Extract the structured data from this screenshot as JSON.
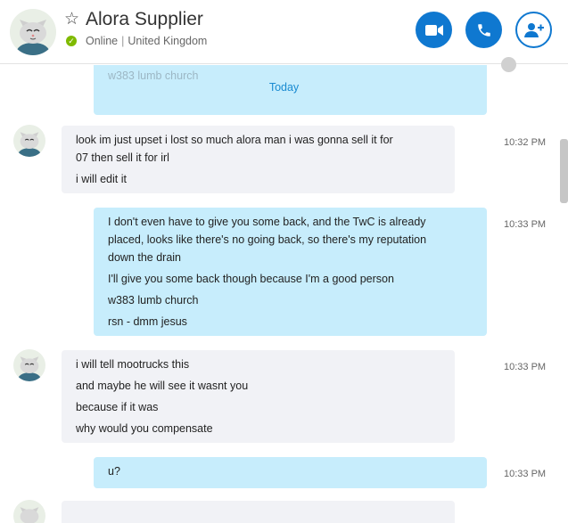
{
  "header": {
    "contact_name": "Alora Supplier",
    "status": "Online",
    "location": "United Kingdom",
    "buttons": [
      {
        "name": "video-call",
        "icon": "video-camera-icon"
      },
      {
        "name": "audio-call",
        "icon": "phone-icon"
      },
      {
        "name": "add-people",
        "icon": "add-person-icon"
      }
    ]
  },
  "colors": {
    "accent": "#0f78d0",
    "online": "#7fba00",
    "incoming_bubble": "#f1f2f6",
    "outgoing_bubble": "#c7edfc",
    "divider_text": "#1a8bd1"
  },
  "chat": {
    "previous_fragment": "w383 lumb church",
    "date_divider": "Today",
    "messages": [
      {
        "sender": "contact",
        "time": "10:32 PM",
        "lines": [
          "look im just upset i lost so much alora man i was gonna sell it for",
          "07 then sell it for irl",
          "i will edit it"
        ]
      },
      {
        "sender": "me",
        "time": "10:33 PM",
        "lines": [
          "I don't even have to give you some back, and the TwC is already",
          "placed, looks like there's no going back, so there's my reputation",
          "down the drain",
          "I'll give you some back though because I'm a good person",
          "w383 lumb church",
          "rsn - dmm jesus"
        ]
      },
      {
        "sender": "contact",
        "time": "10:33 PM",
        "lines": [
          "i will tell mootrucks this",
          "and maybe he will see it wasnt you",
          "because if it was",
          "why would you compensate"
        ]
      },
      {
        "sender": "me",
        "time": "10:33 PM",
        "lines": [
          "u?"
        ]
      }
    ]
  }
}
